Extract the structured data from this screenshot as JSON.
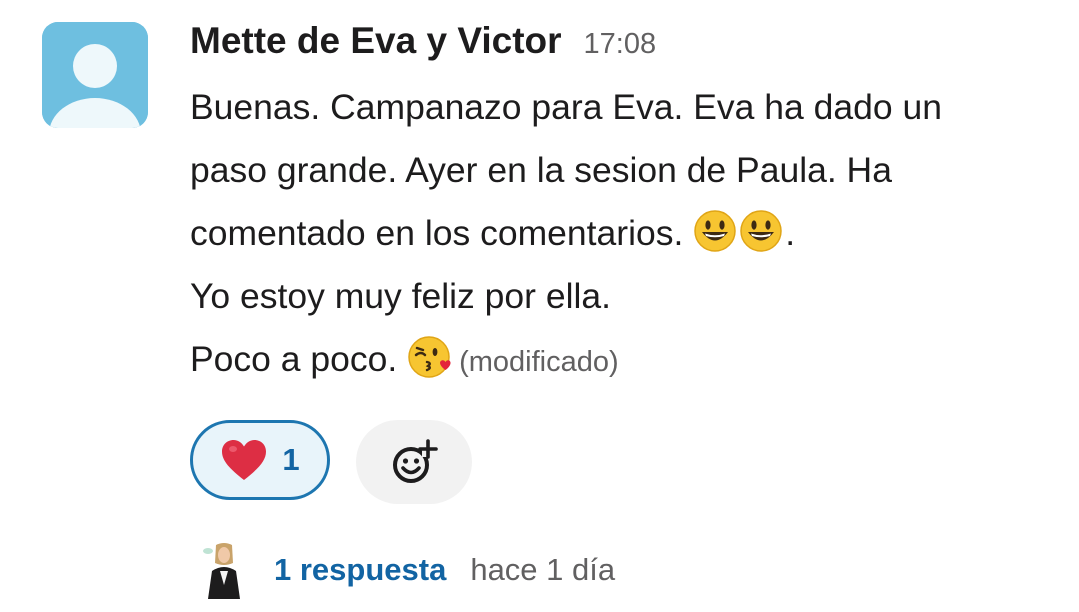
{
  "message": {
    "sender": "Mette de Eva y Victor",
    "time": "17:08",
    "lines": [
      "Buenas. Campanazo para Eva. Eva ha dado un",
      "paso grande. Ayer en la sesion de Paula. Ha",
      "comentado en los comentarios.",
      ".",
      "Yo estoy muy feliz por ella.",
      "Poco a poco."
    ],
    "edited_label": "(modificado)"
  },
  "reactions": [
    {
      "icon": "red-heart-emoji",
      "count": "1",
      "active": true
    }
  ],
  "add_reaction_icon": "add-emoji-icon",
  "thread": {
    "reply_count": "1 respuesta",
    "last_reply": "hace 1 día"
  },
  "colors": {
    "avatar_bg": "#6ebfe0",
    "link_blue": "#1264a3",
    "reaction_border": "#1d76b0",
    "reaction_bg": "#e8f4fa",
    "muted_text": "#616061"
  }
}
